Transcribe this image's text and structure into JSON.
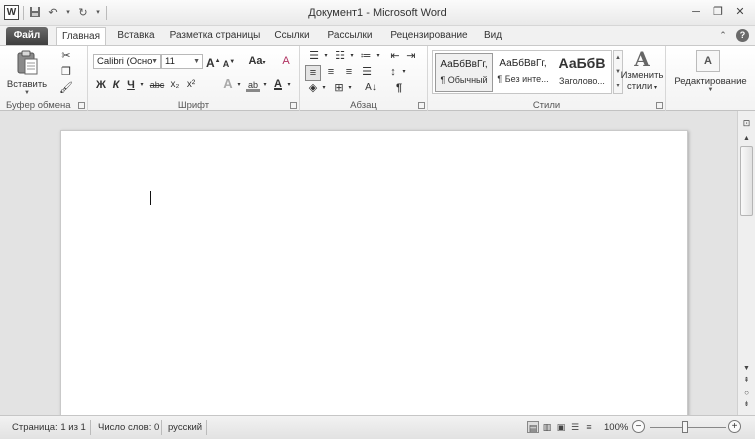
{
  "window": {
    "title": "Документ1 - Microsoft Word",
    "logo_letter": "W",
    "controls": [
      "minimize-icon",
      "restore-icon",
      "close-icon"
    ]
  },
  "qat": {
    "items": [
      "save-icon",
      "undo-icon",
      "redo-icon",
      "customize-icon"
    ]
  },
  "tabs": {
    "file": "Файл",
    "items": [
      "Главная",
      "Вставка",
      "Разметка страницы",
      "Ссылки",
      "Рассылки",
      "Рецензирование",
      "Вид"
    ],
    "active": "Главная",
    "help_symbol": "?"
  },
  "ribbon": {
    "clipboard": {
      "label": "Буфер обмена",
      "paste_label": "Вставить",
      "icons": [
        "paste-icon",
        "cut-icon",
        "copy-icon",
        "format-painter-icon"
      ]
    },
    "font": {
      "label": "Шрифт",
      "font_name": "Calibri (Осно",
      "font_size": "11",
      "grow_symbol": "A",
      "shrink_symbol": "A",
      "case_symbol": "Aa",
      "clear_symbol": "A",
      "bold": "Ж",
      "italic": "К",
      "underline": "Ч",
      "strike": "abc",
      "subscript": "x₂",
      "superscript": "x²",
      "effects_symbol": "A",
      "highlight_symbol": "ab",
      "color_symbol": "A"
    },
    "paragraph": {
      "label": "Абзац",
      "pilcrow": "¶",
      "icons": [
        "bullets-icon",
        "numbering-icon",
        "multilevel-list-icon",
        "decrease-indent-icon",
        "increase-indent-icon",
        "align-left-icon",
        "align-center-icon",
        "align-right-icon",
        "justify-icon",
        "line-spacing-icon",
        "shading-icon",
        "borders-icon",
        "sort-icon",
        "show-marks-icon"
      ]
    },
    "styles": {
      "label": "Стили",
      "items": [
        {
          "sample": "АаБбВвГг,",
          "name": "¶ Обычный"
        },
        {
          "sample": "АаБбВвГг,",
          "name": "¶ Без инте..."
        },
        {
          "sample": "АаБбВ",
          "name": "Заголово..."
        }
      ],
      "selected_index": 0,
      "change_label_1": "Изменить",
      "change_label_2": "стили",
      "change_symbol": "A"
    },
    "editing": {
      "label": "Редактирование",
      "icon": "find-icon"
    }
  },
  "status": {
    "page": "Страница: 1 из 1",
    "words": "Число слов: 0",
    "language": "русский",
    "zoom": "100%",
    "zoom_value": 100,
    "views": [
      "print-layout-icon",
      "full-screen-reading-icon",
      "web-layout-icon",
      "outline-icon",
      "draft-icon"
    ],
    "active_view": "print-layout-icon"
  },
  "colors": {
    "file_tab": "#4f4f4f",
    "workspace": "#e3e3e3"
  }
}
